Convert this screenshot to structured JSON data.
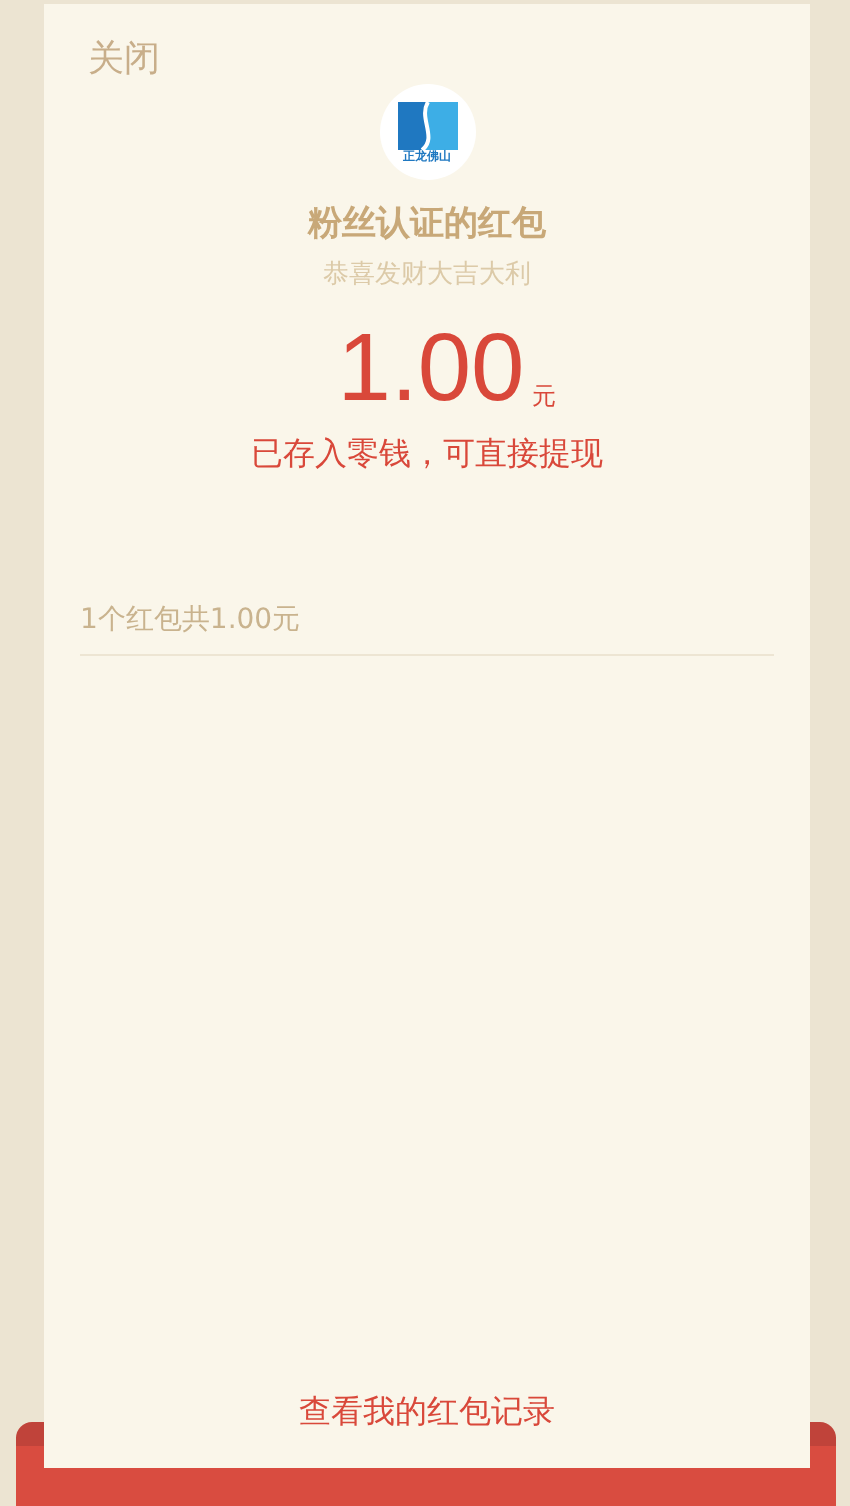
{
  "close_button": "关闭",
  "sender": {
    "logo_text": "正龙佛山",
    "name": "粉丝认证的红包",
    "greeting": "恭喜发财大吉大利"
  },
  "amount": {
    "value": "1.00",
    "unit": "元",
    "note": "已存入零钱，可直接提现"
  },
  "summary": "1个红包共1.00元",
  "records_link": "查看我的红包记录"
}
